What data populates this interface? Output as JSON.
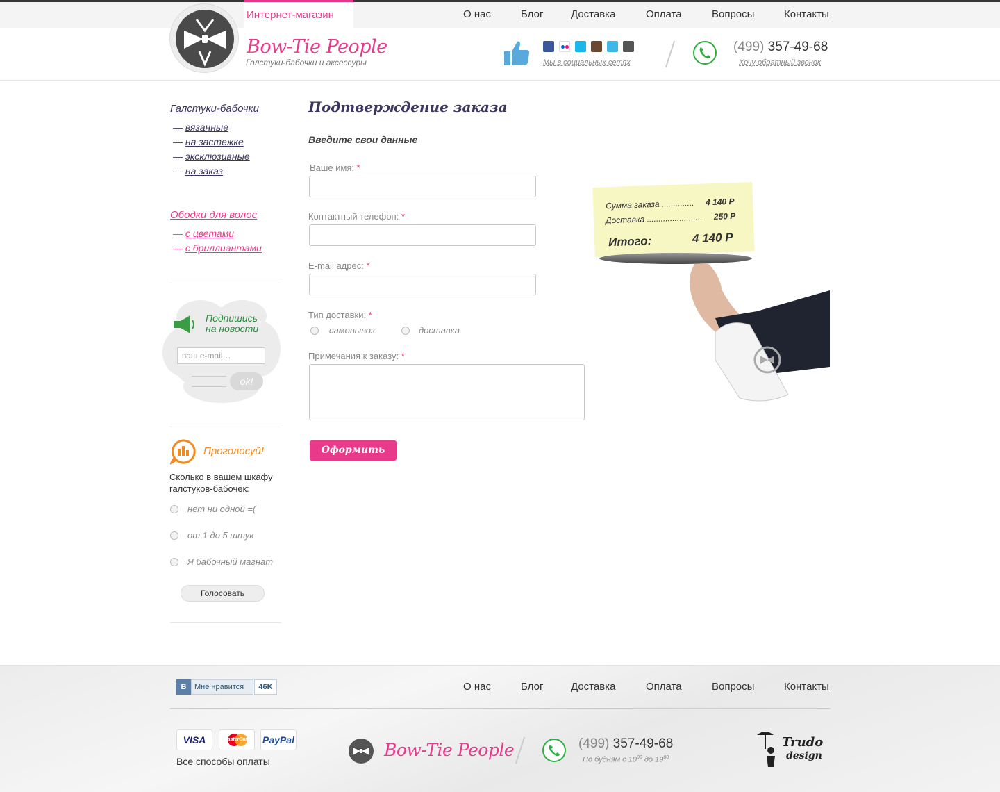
{
  "header": {
    "shop_label": "Интернет-магазин",
    "nav": [
      "О нас",
      "Блог",
      "Доставка",
      "Оплата",
      "Вопросы",
      "Контакты"
    ],
    "brand_name": "Bow-Tie People",
    "brand_subtitle": "Галстуки-бабочки и аксессуры",
    "social_caption": "Мы в социальных сетях",
    "social_icons": [
      "facebook-icon",
      "flickr-icon",
      "vimeo-icon",
      "instagram-icon",
      "twitter-icon",
      "google-plus-icon"
    ],
    "phone_code": "(499)",
    "phone_number": "357-49-68",
    "callback_link": "Хочу обратный звонок"
  },
  "sidebar": {
    "categories": [
      {
        "title": "Галстуки-бабочки",
        "color": "#3b3560",
        "items": [
          "вязанные",
          "на застежке",
          "эксклюзивные",
          "на заказ"
        ]
      },
      {
        "title": "Ободки для волос",
        "color": "#e8398a",
        "items": [
          "с цветами",
          "с бриллиантами"
        ]
      }
    ],
    "subscribe": {
      "title_line1": "Подпишись",
      "title_line2": "на новости",
      "placeholder": "ваш e-mail…",
      "ok_label": "ok!"
    },
    "poll": {
      "title": "Проголосуй!",
      "question": "Сколько в вашем шкафу галстуков-бабочек:",
      "options": [
        "нет ни одной =(",
        "от 1 до 5 штук",
        "Я бабочный магнат"
      ],
      "button": "Голосовать"
    }
  },
  "main": {
    "title": "Подтверждение заказа",
    "subtitle": "Введите свои данные",
    "fields": {
      "name_label": "Ваше имя:",
      "phone_label": "Контактный телефон:",
      "email_label": "E-mail адрес:",
      "delivery_label": "Тип доставки:",
      "delivery_options": [
        "самовывоз",
        "доставка"
      ],
      "notes_label": "Примечания к заказу:",
      "required_mark": "*"
    },
    "submit_label": "Оформить",
    "receipt": {
      "sum_label": "Сумма заказа ..............",
      "sum_value": "4 140 Р",
      "delivery_label": "Доставка ........................",
      "delivery_value": "250 Р",
      "total_label": "Итого:",
      "total_value": "4 140 Р"
    }
  },
  "footer": {
    "vk": {
      "letter": "В",
      "like_label": "Мне нравится",
      "count": "46K"
    },
    "nav": [
      "О нас",
      "Блог",
      "Доставка",
      "Оплата",
      "Вопросы",
      "Контакты"
    ],
    "payment_cards": [
      "VISA",
      "MasterCard",
      "PayPal"
    ],
    "payment_link": "Все способы оплаты",
    "brand_name": "Bow-Tie People",
    "phone_code": "(499)",
    "phone_number": "357-49-68",
    "hours": {
      "prefix": "По будням с 10",
      "sup1": "00",
      "mid": " до 19",
      "sup2": "00"
    },
    "designer": {
      "line1": "Trudo",
      "line2": "design"
    }
  },
  "colors": {
    "accent": "#e8398a",
    "title": "#3b3560",
    "green": "#2eae3f",
    "orange": "#f28a1f"
  }
}
